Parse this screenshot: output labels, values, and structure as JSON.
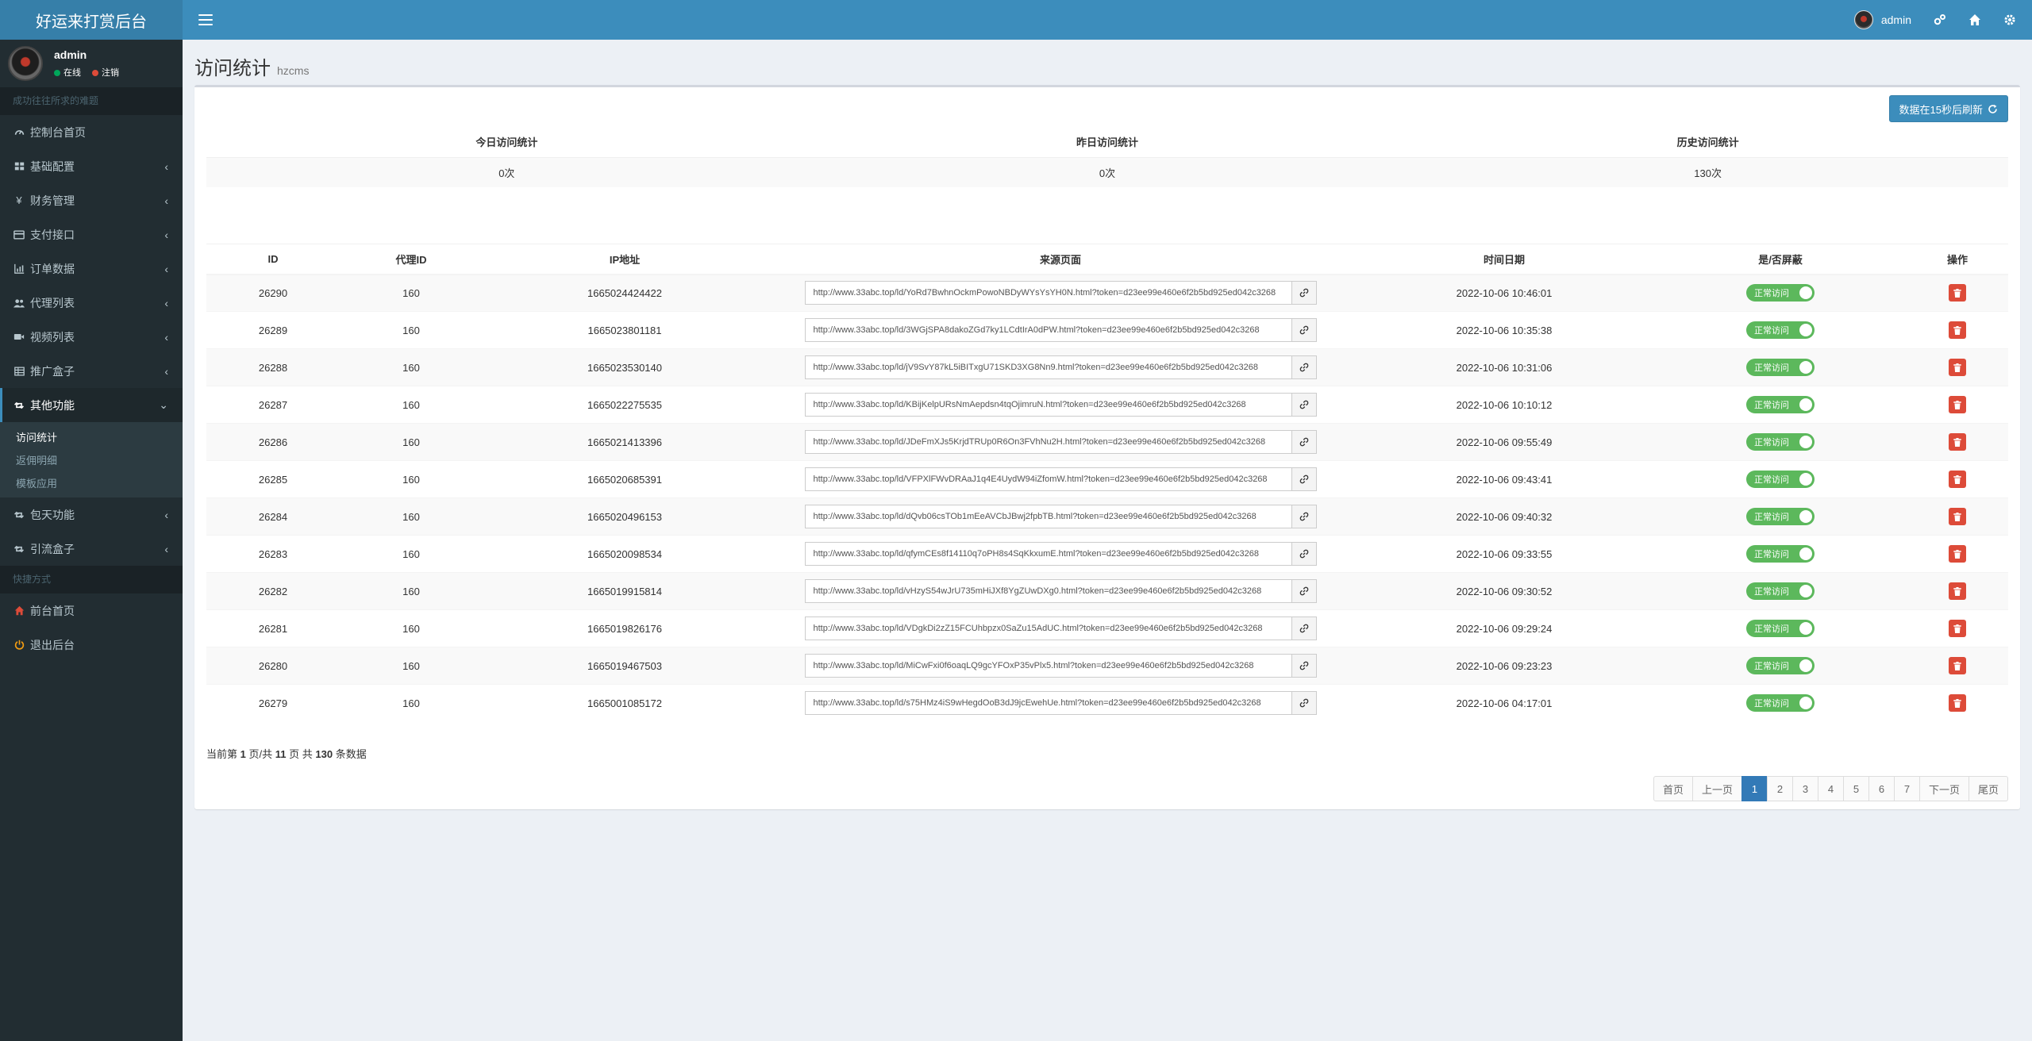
{
  "brand": {
    "title": "好运来打赏后台"
  },
  "navbar": {
    "username": "admin"
  },
  "sidebar": {
    "user": {
      "name": "admin",
      "status_online": "在线",
      "status_logout": "注销"
    },
    "header_main": "成功往往所求的难题",
    "items": [
      {
        "label": "控制台首页",
        "icon": "speedometer-icon",
        "has_chevron": false
      },
      {
        "label": "基础配置",
        "icon": "grid-icon",
        "has_chevron": true
      },
      {
        "label": "财务管理",
        "icon": "yen-icon",
        "has_chevron": true
      },
      {
        "label": "支付接口",
        "icon": "credit-card-icon",
        "has_chevron": true
      },
      {
        "label": "订单数据",
        "icon": "bar-chart-icon",
        "has_chevron": true
      },
      {
        "label": "代理列表",
        "icon": "users-icon",
        "has_chevron": true
      },
      {
        "label": "视频列表",
        "icon": "video-icon",
        "has_chevron": true
      },
      {
        "label": "推广盒子",
        "icon": "table-icon",
        "has_chevron": true
      },
      {
        "label": "其他功能",
        "icon": "retweet-icon",
        "has_chevron": true,
        "active": true
      }
    ],
    "submenu": [
      {
        "label": "访问统计",
        "active": true
      },
      {
        "label": "返佣明细",
        "active": false
      },
      {
        "label": "模板应用",
        "active": false
      }
    ],
    "items_after": [
      {
        "label": "包天功能",
        "icon": "retweet-icon"
      },
      {
        "label": "引流盒子",
        "icon": "retweet-icon"
      }
    ],
    "header_shortcuts": "快捷方式",
    "shortcuts": [
      {
        "label": "前台首页",
        "icon": "home-icon",
        "color": "#dd4b39"
      },
      {
        "label": "退出后台",
        "icon": "power-icon",
        "color": "#f39c12"
      }
    ]
  },
  "page": {
    "title": "访问统计",
    "subtitle": "hzcms"
  },
  "refresh_button": "数据在15秒后刷新",
  "stats": {
    "headers": [
      "今日访问统计",
      "昨日访问统计",
      "历史访问统计"
    ],
    "values": [
      "0次",
      "0次",
      "130次"
    ]
  },
  "table": {
    "headers": [
      "ID",
      "代理ID",
      "IP地址",
      "来源页面",
      "时间日期",
      "是/否屏蔽",
      "操作"
    ],
    "toggle_label": "正常访问",
    "rows": [
      {
        "id": "26290",
        "agent": "160",
        "ip": "1665024424422",
        "url": "http://www.33abc.top/ld/YoRd7BwhnOckmPowoNBDyWYsYsYH0N.html?token=d23ee99e460e6f2b5bd925ed042c3268",
        "time": "2022-10-06 10:46:01"
      },
      {
        "id": "26289",
        "agent": "160",
        "ip": "1665023801181",
        "url": "http://www.33abc.top/ld/3WGjSPA8dakoZGd7ky1LCdtIrA0dPW.html?token=d23ee99e460e6f2b5bd925ed042c3268",
        "time": "2022-10-06 10:35:38"
      },
      {
        "id": "26288",
        "agent": "160",
        "ip": "1665023530140",
        "url": "http://www.33abc.top/ld/jV9SvY87kL5iBITxgU71SKD3XG8Nn9.html?token=d23ee99e460e6f2b5bd925ed042c3268",
        "time": "2022-10-06 10:31:06"
      },
      {
        "id": "26287",
        "agent": "160",
        "ip": "1665022275535",
        "url": "http://www.33abc.top/ld/KBijKelpURsNmAepdsn4tqOjimruN.html?token=d23ee99e460e6f2b5bd925ed042c3268",
        "time": "2022-10-06 10:10:12"
      },
      {
        "id": "26286",
        "agent": "160",
        "ip": "1665021413396",
        "url": "http://www.33abc.top/ld/JDeFmXJs5KrjdTRUp0R6On3FVhNu2H.html?token=d23ee99e460e6f2b5bd925ed042c3268",
        "time": "2022-10-06 09:55:49"
      },
      {
        "id": "26285",
        "agent": "160",
        "ip": "1665020685391",
        "url": "http://www.33abc.top/ld/VFPXlFWvDRAaJ1q4E4UydW94iZfomW.html?token=d23ee99e460e6f2b5bd925ed042c3268",
        "time": "2022-10-06 09:43:41"
      },
      {
        "id": "26284",
        "agent": "160",
        "ip": "1665020496153",
        "url": "http://www.33abc.top/ld/dQvb06csTOb1mEeAVCbJBwj2fpbTB.html?token=d23ee99e460e6f2b5bd925ed042c3268",
        "time": "2022-10-06 09:40:32"
      },
      {
        "id": "26283",
        "agent": "160",
        "ip": "1665020098534",
        "url": "http://www.33abc.top/ld/qfymCEs8f14110q7oPH8s4SqKkxumE.html?token=d23ee99e460e6f2b5bd925ed042c3268",
        "time": "2022-10-06 09:33:55"
      },
      {
        "id": "26282",
        "agent": "160",
        "ip": "1665019915814",
        "url": "http://www.33abc.top/ld/vHzyS54wJrU735mHiJXf8YgZUwDXg0.html?token=d23ee99e460e6f2b5bd925ed042c3268",
        "time": "2022-10-06 09:30:52"
      },
      {
        "id": "26281",
        "agent": "160",
        "ip": "1665019826176",
        "url": "http://www.33abc.top/ld/VDgkDi2zZ15FCUhbpzx0SaZu15AdUC.html?token=d23ee99e460e6f2b5bd925ed042c3268",
        "time": "2022-10-06 09:29:24"
      },
      {
        "id": "26280",
        "agent": "160",
        "ip": "1665019467503",
        "url": "http://www.33abc.top/ld/MiCwFxi0f6oaqLQ9gcYFOxP35vPlx5.html?token=d23ee99e460e6f2b5bd925ed042c3268",
        "time": "2022-10-06 09:23:23"
      },
      {
        "id": "26279",
        "agent": "160",
        "ip": "1665001085172",
        "url": "http://www.33abc.top/ld/s75HMz4iS9wHegdOoB3dJ9jcEwehUe.html?token=d23ee99e460e6f2b5bd925ed042c3268",
        "time": "2022-10-06 04:17:01"
      }
    ]
  },
  "page_info": {
    "prefix": "当前第",
    "current": "1",
    "mid1": "页/共",
    "total_pages": "11",
    "mid2": "页 共",
    "total_rows": "130",
    "suffix": "条数据"
  },
  "pagination": [
    "首页",
    "上一页",
    "1",
    "2",
    "3",
    "4",
    "5",
    "6",
    "7",
    "下一页",
    "尾页"
  ],
  "pagination_active": "1",
  "colors": {
    "header": "#3c8dbc",
    "brand": "#367fa9",
    "sidebar": "#222d32",
    "toggle_on": "#5cb85c",
    "delete": "#dd4b39",
    "online": "#00a65a",
    "logout": "#dd4b39"
  }
}
